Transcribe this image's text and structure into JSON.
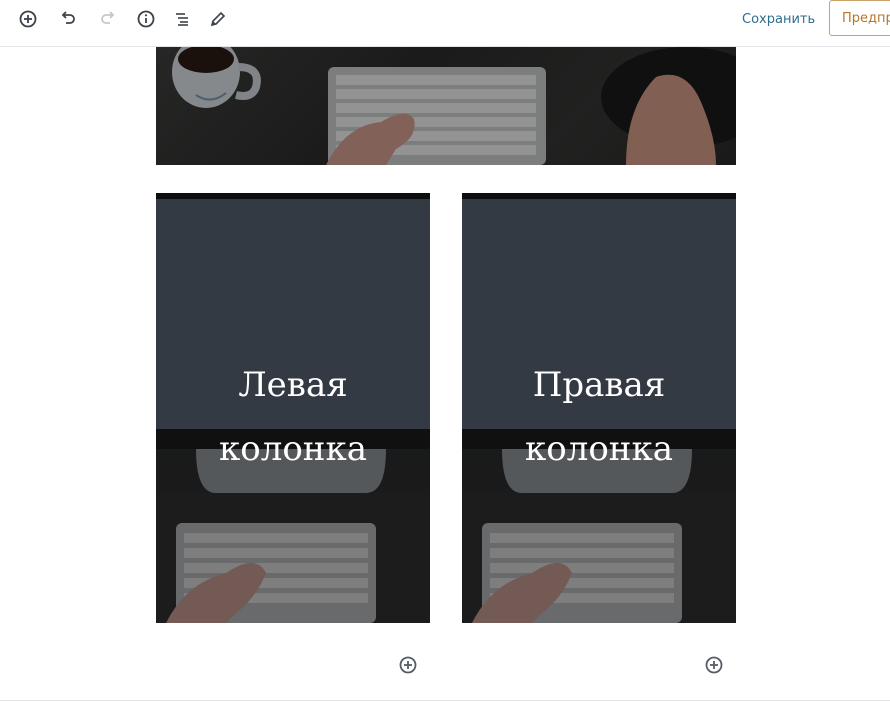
{
  "toolbar": {
    "icons": [
      "add-block-icon",
      "undo-icon",
      "redo-icon",
      "info-icon",
      "outline-icon",
      "edit-icon"
    ],
    "save_label": "Сохранить",
    "preview_label": "Предпросмотр"
  },
  "columns": {
    "left": {
      "text_line1": "Левая",
      "text_line2": "колонка"
    },
    "right": {
      "text_line1": "Правая",
      "text_line2": "колонка"
    }
  },
  "colors": {
    "save_link": "#2e6e8e",
    "preview_border": "#c9a26a",
    "preview_text": "#b5752a",
    "icon_default": "#555d66",
    "icon_disabled": "#c4c8cc"
  }
}
